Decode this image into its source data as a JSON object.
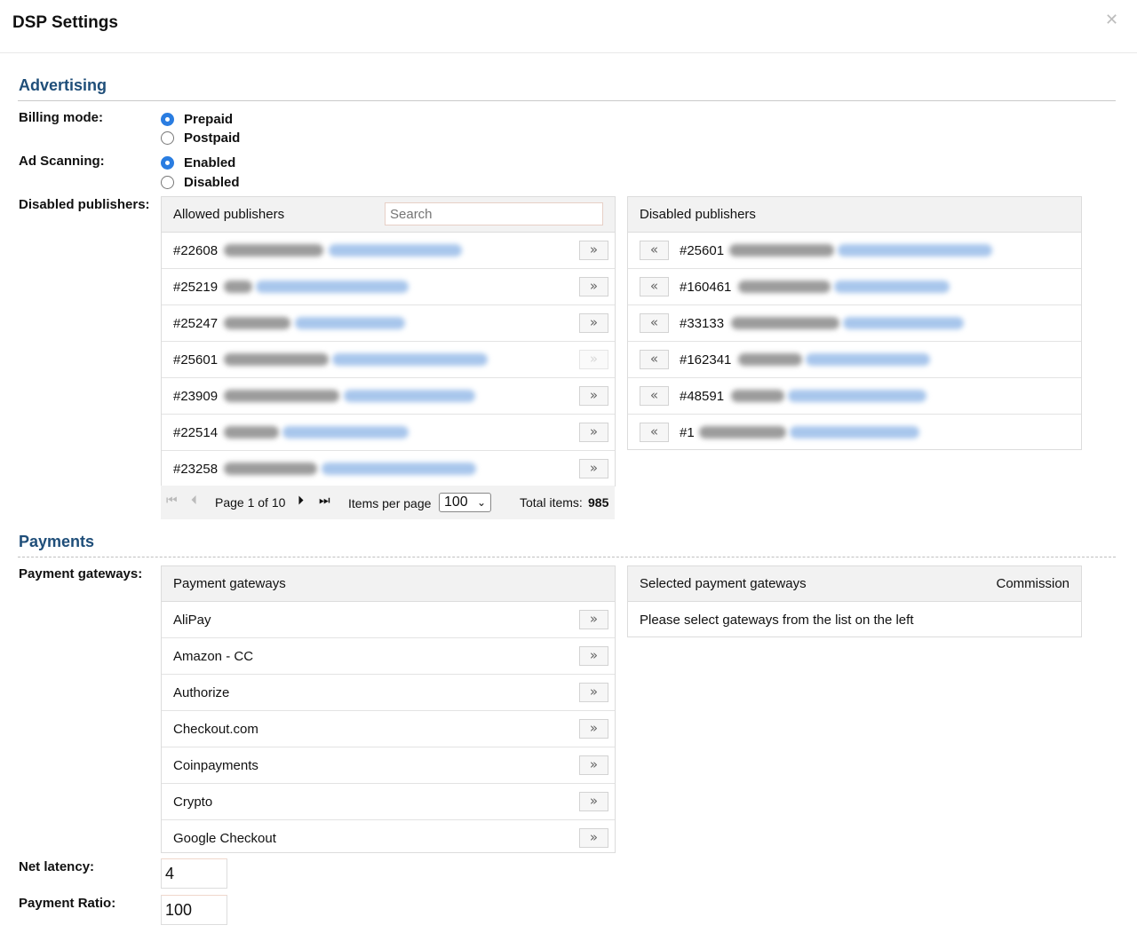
{
  "dialog": {
    "title": "DSP Settings"
  },
  "sections": {
    "advertising": "Advertising",
    "payments": "Payments"
  },
  "billing": {
    "label": "Billing mode:",
    "options": [
      "Prepaid",
      "Postpaid"
    ],
    "selected": "Prepaid"
  },
  "scanning": {
    "label": "Ad Scanning:",
    "options": [
      "Enabled",
      "Disabled"
    ],
    "selected": "Enabled"
  },
  "publishers": {
    "label": "Disabled publishers:",
    "allowed_title": "Allowed publishers",
    "search_placeholder": "Search",
    "disabled_title": "Disabled publishers",
    "allowed_ids": [
      "#22608",
      "#25219",
      "#25247",
      "#25601",
      "#23909",
      "#22514",
      "#23258"
    ],
    "disabled_ids": [
      "#25601",
      "#160461",
      "#33133",
      "#162341",
      "#48591",
      "#1"
    ],
    "move_right_glyph": "»",
    "move_left_glyph": "«"
  },
  "pager": {
    "page_text": "Page 1 of 10",
    "items_per_page_label": "Items per page",
    "items_per_page": "100",
    "total_label": "Total items:",
    "total": "985"
  },
  "gateways": {
    "label": "Payment gateways:",
    "list_title": "Payment gateways",
    "selected_title": "Selected payment gateways",
    "commission_title": "Commission",
    "items": [
      "AliPay",
      "Amazon - CC",
      "Authorize",
      "Checkout.com",
      "Coinpayments",
      "Crypto",
      "Google Checkout"
    ],
    "empty_message": "Please select gateways from the list on the left"
  },
  "net_latency": {
    "label": "Net latency:",
    "value": "4"
  },
  "payment_ratio": {
    "label": "Payment Ratio:",
    "value": "100"
  }
}
